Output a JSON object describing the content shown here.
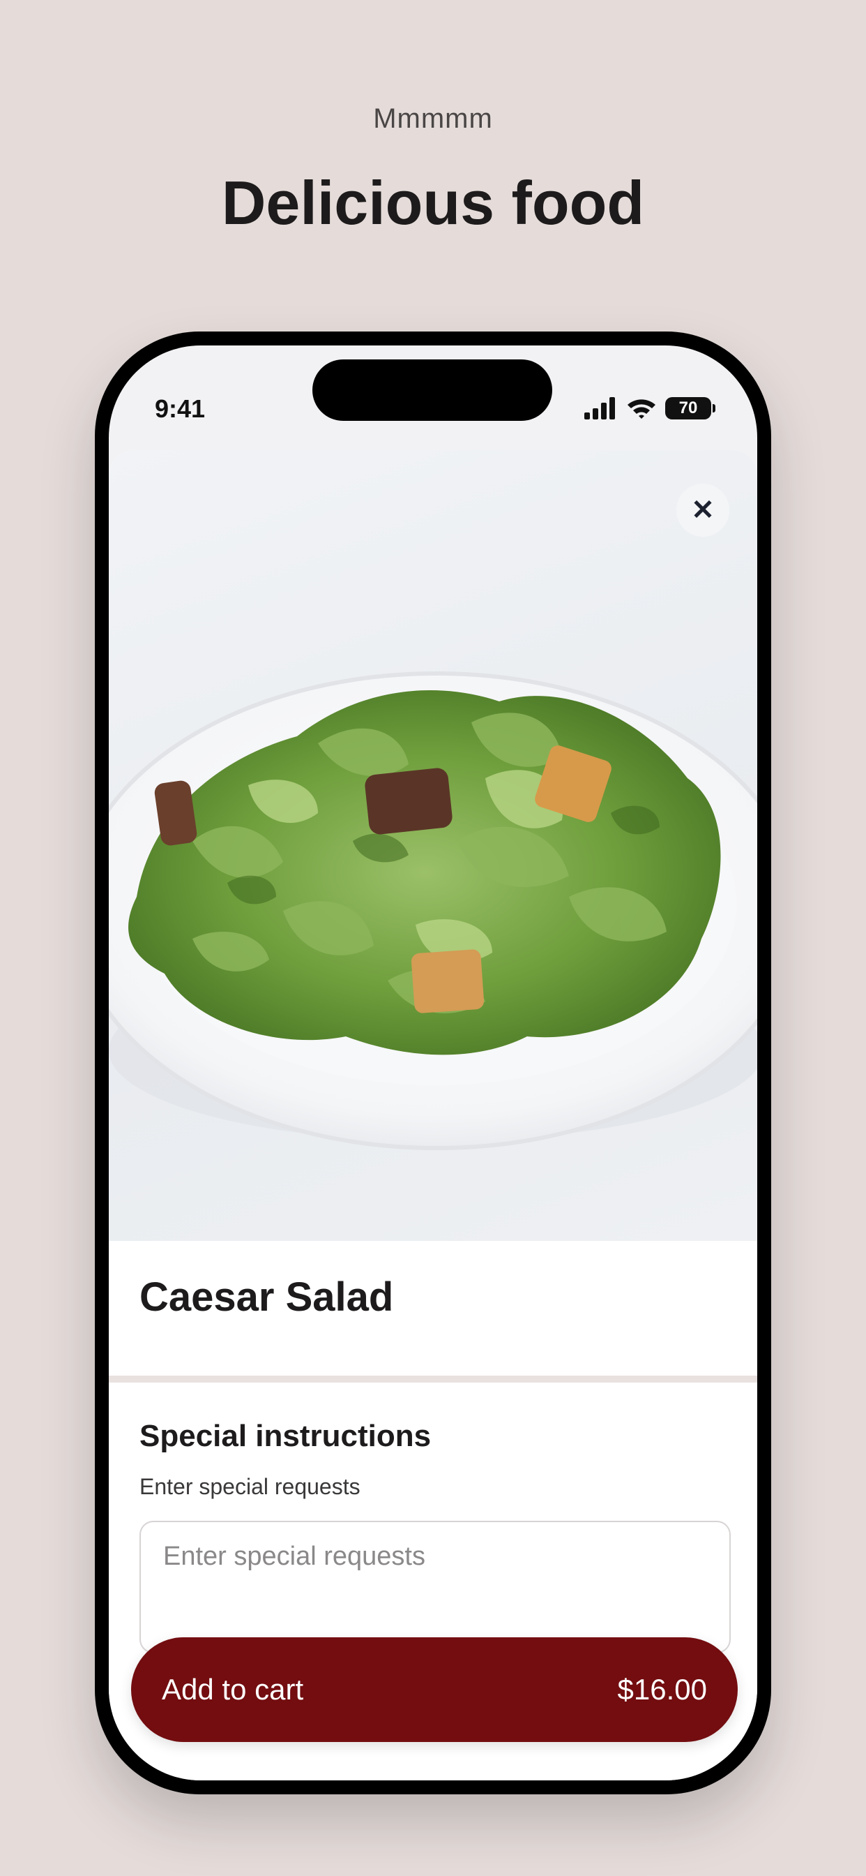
{
  "promo": {
    "eyebrow": "Mmmmm",
    "title": "Delicious food"
  },
  "status_bar": {
    "time": "9:41",
    "battery": "70",
    "icons": [
      "cellular-signal-icon",
      "wifi-icon",
      "battery-icon"
    ]
  },
  "item": {
    "image_subject": "caesar-salad-photo",
    "title": "Caesar Salad"
  },
  "instructions": {
    "title": "Special instructions",
    "subtitle": "Enter special requests",
    "placeholder": "Enter special requests",
    "value": ""
  },
  "cart": {
    "label": "Add to cart",
    "price": "$16.00"
  },
  "colors": {
    "background": "#e5dcda",
    "accent": "#730d10"
  }
}
